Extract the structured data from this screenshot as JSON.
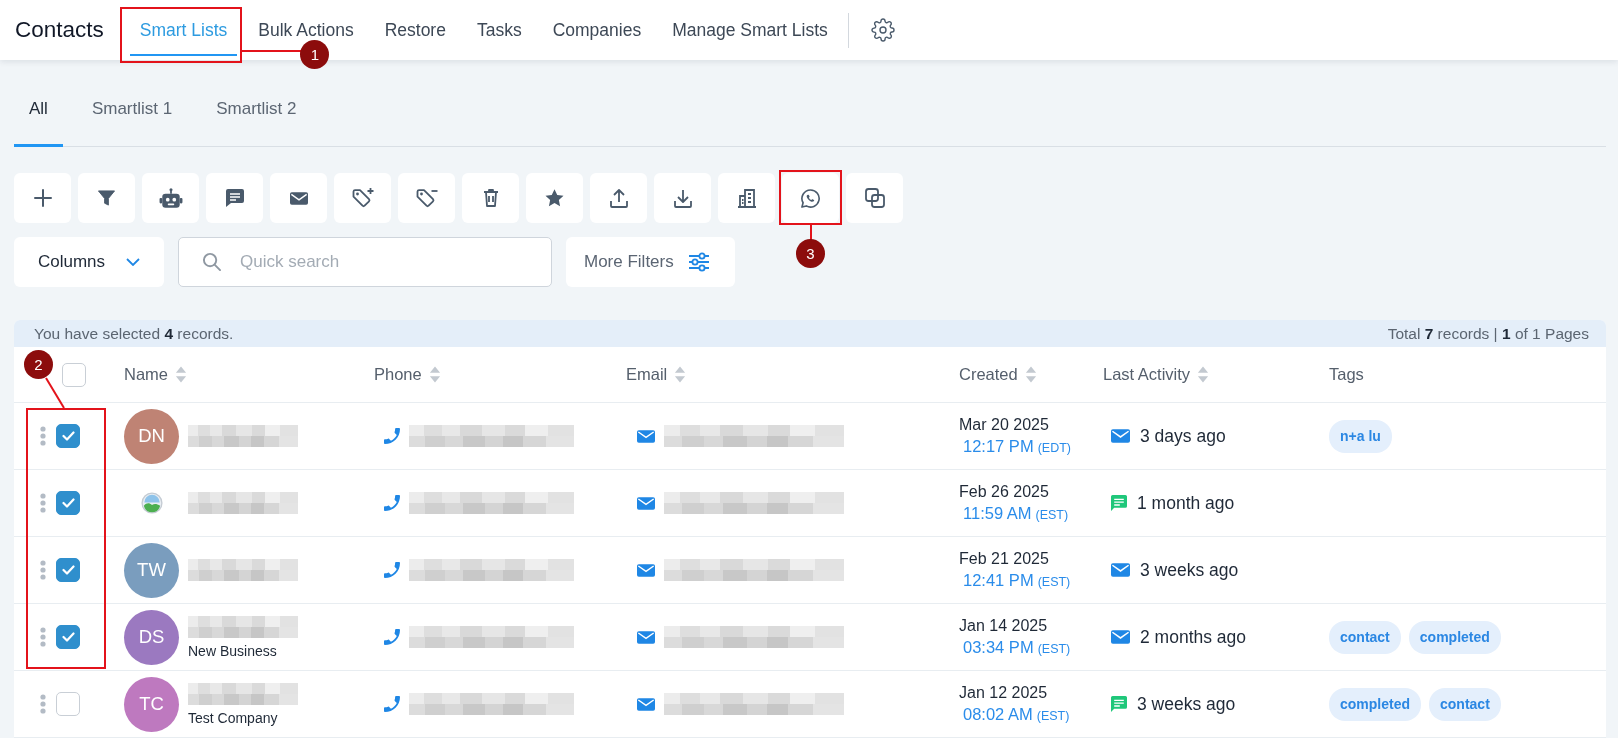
{
  "header": {
    "title": "Contacts",
    "nav_tabs": [
      {
        "label": "Smart Lists",
        "selected": true,
        "callout": "1"
      },
      {
        "label": "Bulk Actions",
        "selected": false
      },
      {
        "label": "Restore",
        "selected": false
      },
      {
        "label": "Tasks",
        "selected": false
      },
      {
        "label": "Companies",
        "selected": false
      },
      {
        "label": "Manage Smart Lists",
        "selected": false
      }
    ]
  },
  "list_tabs": [
    {
      "label": "All",
      "selected": true
    },
    {
      "label": "Smartlist 1",
      "selected": false
    },
    {
      "label": "Smartlist 2",
      "selected": false
    }
  ],
  "toolbar": {
    "actions": [
      {
        "kind": "add"
      },
      {
        "kind": "filter"
      },
      {
        "kind": "robot"
      },
      {
        "kind": "message"
      },
      {
        "kind": "email"
      },
      {
        "kind": "tag-add"
      },
      {
        "kind": "tag-remove"
      },
      {
        "kind": "delete"
      },
      {
        "kind": "star"
      },
      {
        "kind": "export"
      },
      {
        "kind": "import"
      },
      {
        "kind": "company"
      },
      {
        "kind": "phone-chat",
        "callout": "3"
      },
      {
        "kind": "duplicate"
      }
    ]
  },
  "filters": {
    "columns_label": "Columns",
    "search": {
      "placeholder": "Quick search"
    },
    "more_filters_label": "More Filters"
  },
  "table": {
    "selection_summary": "You have selected **4** records.",
    "pagination": "Total **7** records | **1** of 1 Pages",
    "all_selected": false,
    "callout": "2",
    "columns": [
      {
        "label": "Name",
        "sortable": true
      },
      {
        "label": "Phone",
        "sortable": true
      },
      {
        "label": "Email",
        "sortable": true
      },
      {
        "label": "Created",
        "sortable": true
      },
      {
        "label": "Last Activity",
        "sortable": true
      },
      {
        "label": "Tags",
        "sortable": false
      }
    ],
    "rows": [
      {
        "selected": true,
        "avatar": {
          "kind": "initials",
          "initials": "DN",
          "color": "#bf8374"
        },
        "redacted": true,
        "created_date": "Mar 20 2025",
        "created_time": "12:17 PM",
        "timezone": "(EDT)",
        "activity": {
          "kind": "email",
          "text": "3 days ago"
        },
        "tags": [
          "n+a lu"
        ]
      },
      {
        "selected": true,
        "avatar": {
          "kind": "image"
        },
        "redacted": true,
        "created_date": "Feb 26 2025",
        "created_time": "11:59 AM",
        "timezone": "(EST)",
        "activity": {
          "kind": "sms",
          "text": "1 month ago"
        }
      },
      {
        "selected": true,
        "avatar": {
          "kind": "initials",
          "initials": "TW",
          "color": "#7a9dbe"
        },
        "redacted": true,
        "created_date": "Feb 21 2025",
        "created_time": "12:41 PM",
        "timezone": "(EST)",
        "activity": {
          "kind": "email",
          "text": "3 weeks ago"
        }
      },
      {
        "selected": true,
        "avatar": {
          "kind": "initials",
          "initials": "DS",
          "color": "#9b79c0"
        },
        "redacted": true,
        "company": "New Business",
        "created_date": "Jan 14 2025",
        "created_time": "03:34 PM",
        "timezone": "(EST)",
        "activity": {
          "kind": "email",
          "text": "2 months ago"
        },
        "tags": [
          "contact",
          "completed"
        ]
      },
      {
        "selected": false,
        "avatar": {
          "kind": "initials",
          "initials": "TC",
          "color": "#be79bf"
        },
        "redacted": true,
        "company": "Test Company",
        "created_date": "Jan 12 2025",
        "created_time": "08:02 AM",
        "timezone": "(EST)",
        "activity": {
          "kind": "sms",
          "text": "3 weeks ago"
        },
        "tags": [
          "completed",
          "contact"
        ]
      }
    ]
  }
}
